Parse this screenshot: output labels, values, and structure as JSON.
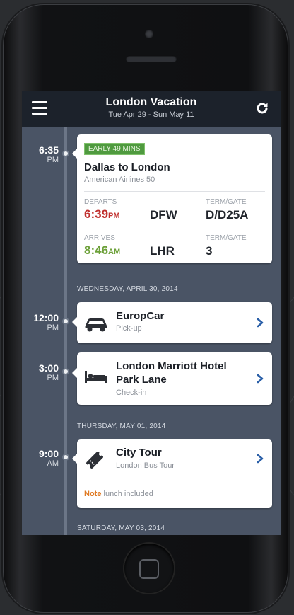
{
  "app": {
    "title": "London Vacation",
    "subtitle": "Tue Apr 29 - Sun May 11"
  },
  "colors": {
    "navbar": "#1c222b",
    "screen_bg": "#4a5465",
    "early_badge": "#4f9a3f",
    "departs_time": "#c0302e",
    "arrives_time": "#6da13a",
    "note_label": "#e07b25",
    "chevron": "#2a5fa8"
  },
  "items": [
    {
      "time": "6:35",
      "ampm": "PM",
      "badge": "EARLY 49 MINS",
      "title": "Dallas to London",
      "subtitle": "American Airlines 50",
      "depart_label": "DEPARTS",
      "depart_time": "6:39",
      "depart_ampm": "PM",
      "depart_code": "DFW",
      "depart_gate_label": "TERM/GATE",
      "depart_gate": "D/D25A",
      "arrive_label": "ARRIVES",
      "arrive_time": "8:46",
      "arrive_ampm": "AM",
      "arrive_code": "LHR",
      "arrive_gate_label": "TERM/GATE",
      "arrive_gate": "3"
    },
    {
      "time": "12:00",
      "ampm": "PM",
      "icon": "car-icon",
      "title": "EuropCar",
      "subtitle": "Pick-up"
    },
    {
      "time": "3:00",
      "ampm": "PM",
      "icon": "bed-icon",
      "title_line1": "London Marriott Hotel",
      "title_line2": "Park Lane",
      "subtitle": "Check-in"
    },
    {
      "time": "9:00",
      "ampm": "AM",
      "icon": "ticket-icon",
      "title": "City Tour",
      "subtitle": "London Bus Tour",
      "note_label": "Note",
      "note_text": "lunch included"
    }
  ],
  "sections": {
    "wed": "WEDNESDAY, APRIL 30, 2014",
    "thu": "THURSDAY, MAY 01, 2014",
    "sat": "SATURDAY, MAY 03, 2014"
  }
}
